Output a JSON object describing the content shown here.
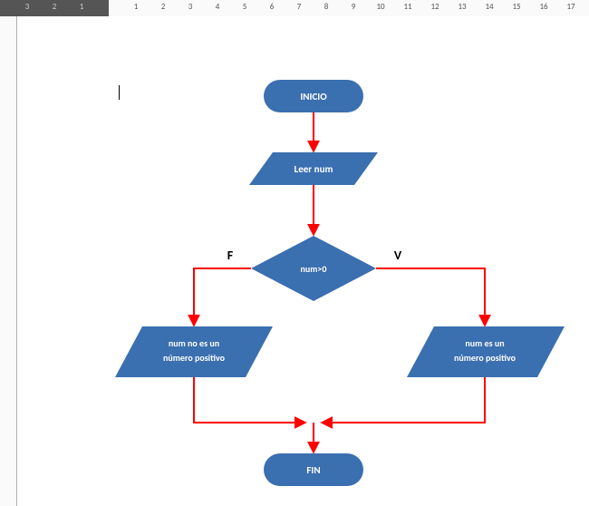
{
  "ruler": {
    "negTicks": [
      "3",
      "2",
      "1"
    ],
    "posTicks": [
      "1",
      "2",
      "3",
      "4",
      "5",
      "6",
      "7",
      "8",
      "9",
      "10",
      "11",
      "12",
      "13",
      "14",
      "15",
      "16",
      "17"
    ]
  },
  "flow": {
    "start": "INICIO",
    "read": "Leer num",
    "cond": "num>0",
    "falseLabel": "F",
    "trueLabel": "V",
    "falseOut1": "num no es un",
    "falseOut2": "número positivo",
    "trueOut1": "num es un",
    "trueOut2": "número positivo",
    "end": "FIN"
  }
}
